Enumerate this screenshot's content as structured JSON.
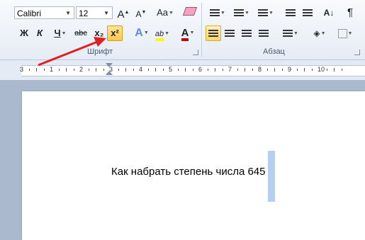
{
  "ribbon": {
    "font_group": {
      "label": "Шрифт",
      "font_name": "Calibri",
      "font_size": "12",
      "grow_font": "A",
      "shrink_font": "A",
      "change_case": "Aa",
      "bold": "Ж",
      "italic": "К",
      "underline": "Ч",
      "strikethrough": "abc",
      "subscript": "x₂",
      "superscript": "x²",
      "highlight": "ab",
      "font_color": "A",
      "font_color_hex": "#c00000",
      "highlight_color_hex": "#ffff00"
    },
    "paragraph_group": {
      "label": "Абзац",
      "pilcrow": "¶",
      "sort": "А↓Я"
    }
  },
  "ruler": {
    "numbers": [
      "3",
      "1",
      "2",
      "3",
      "4",
      "5",
      "6",
      "7",
      "8",
      "9",
      "10"
    ]
  },
  "document": {
    "text": "Как набрать степень числа 645"
  },
  "annotation": {
    "arrow_color": "#e02020"
  }
}
